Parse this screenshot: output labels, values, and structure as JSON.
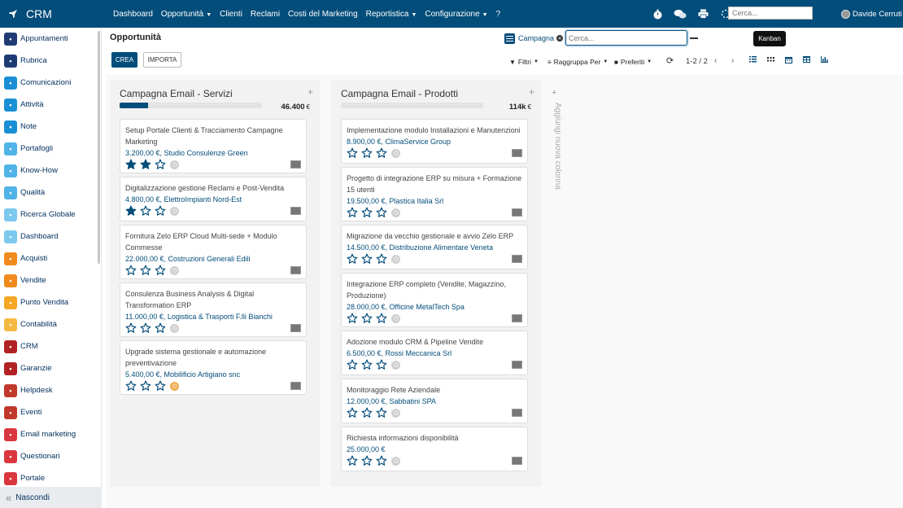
{
  "app": {
    "name": "CRM"
  },
  "topnav": {
    "items": [
      {
        "label": "Dashboard",
        "dropdown": false
      },
      {
        "label": "Opportunità",
        "dropdown": true
      },
      {
        "label": "Clienti",
        "dropdown": false
      },
      {
        "label": "Reclami",
        "dropdown": false
      },
      {
        "label": "Costi del Marketing",
        "dropdown": false
      },
      {
        "label": "Reportistica",
        "dropdown": true
      },
      {
        "label": "Configurazione",
        "dropdown": true
      },
      {
        "label": "?",
        "dropdown": false
      }
    ],
    "search_placeholder": "Cerca...",
    "user_name": "Davide Cerruti"
  },
  "sidebar": {
    "items": [
      {
        "label": "Appuntamenti",
        "color": "#1f3b73",
        "icon": "calendar-icon"
      },
      {
        "label": "Rubrica",
        "color": "#1f3b73",
        "icon": "contacts-icon"
      },
      {
        "label": "Comunicazioni",
        "color": "#1a8fd6",
        "icon": "chat-icon"
      },
      {
        "label": "Attività",
        "color": "#1a8fd6",
        "icon": "checkbox-icon"
      },
      {
        "label": "Note",
        "color": "#1a8fd6",
        "icon": "note-icon"
      },
      {
        "label": "Portafogli",
        "color": "#4fb3e8",
        "icon": "wallet-icon"
      },
      {
        "label": "Know-How",
        "color": "#4fb3e8",
        "icon": "lightbulb-icon"
      },
      {
        "label": "Qualità",
        "color": "#4fb3e8",
        "icon": "quality-icon"
      },
      {
        "label": "Ricerca Globale",
        "color": "#7cc8ee",
        "icon": "search-icon"
      },
      {
        "label": "Dashboard",
        "color": "#7cc8ee",
        "icon": "dashboard-icon"
      },
      {
        "label": "Acquisti",
        "color": "#f08a1c",
        "icon": "purchase-icon"
      },
      {
        "label": "Vendite",
        "color": "#f08a1c",
        "icon": "sales-icon"
      },
      {
        "label": "Punto Vendita",
        "color": "#f5a623",
        "icon": "pos-icon"
      },
      {
        "label": "Contabilità",
        "color": "#f5b942",
        "icon": "accounting-icon"
      },
      {
        "label": "CRM",
        "color": "#b22222",
        "icon": "crm-icon"
      },
      {
        "label": "Garanzie",
        "color": "#b22222",
        "icon": "warranty-icon"
      },
      {
        "label": "Helpdesk",
        "color": "#c0392b",
        "icon": "helpdesk-icon"
      },
      {
        "label": "Eventi",
        "color": "#c0392b",
        "icon": "events-icon"
      },
      {
        "label": "Email marketing",
        "color": "#d9363e",
        "icon": "email-icon"
      },
      {
        "label": "Questionari",
        "color": "#d9363e",
        "icon": "survey-icon"
      },
      {
        "label": "Portale",
        "color": "#d9363e",
        "icon": "portal-icon"
      }
    ],
    "hide_label": "Nascondi"
  },
  "control": {
    "title": "Opportunità",
    "create_label": "CREA",
    "import_label": "IMPORTA",
    "facet_label": "Campagna",
    "search_placeholder": "Cerca...",
    "tooltip": "Kanban",
    "filters_label": "Filtri",
    "groupby_label": "Raggruppa Per",
    "favorites_label": "Preferiti",
    "pager": "1-2 / 2"
  },
  "kanban": {
    "add_column_label": "Aggiungi nuova colonna",
    "columns": [
      {
        "title": "Campagna Email - Servizi",
        "total": "46.400",
        "currency": "€",
        "progress": 0.2,
        "cards": [
          {
            "title": "Setup Portale Clienti & Tracciamento Campagne Marketing",
            "sub": "3.200,00 €, Studio Consulenze Green",
            "stars": 2,
            "activity": "none"
          },
          {
            "title": "Digitalizzazione gestione Reclami e Post-Vendita",
            "sub": "4.800,00 €, ElettroImpianti Nord-Est",
            "stars": 1,
            "activity": "none"
          },
          {
            "title": "Fornitura Zelo ERP Cloud Multi-sede + Modulo Commesse",
            "sub": "22.000,00 €, Costruzioni Generali Edili",
            "stars": 0,
            "activity": "none"
          },
          {
            "title": "Consulenza Business Analysis & Digital Transformation ERP",
            "sub": "11.000,00 €, Logistica & Trasporti F.lli Bianchi",
            "stars": 0,
            "activity": "none"
          },
          {
            "title": "Upgrade sistema gestionale e automazione preventivazione",
            "sub": "5.400,00 €, Mobilificio Artigiano snc",
            "stars": 0,
            "activity": "warning"
          }
        ]
      },
      {
        "title": "Campagna Email - Prodotti",
        "total": "114k",
        "currency": "€",
        "progress": 0,
        "cards": [
          {
            "title": "Implementazione modulo Installazioni e Manutenzioni",
            "sub": "8.900,00 €, ClimaService Group",
            "stars": 0,
            "activity": "none"
          },
          {
            "title": "Progetto di integrazione ERP su misura + Formazione 15 utenti",
            "sub": "19.500,00 €, Plastica Italia Srl",
            "stars": 0,
            "activity": "none"
          },
          {
            "title": "Migrazione da vecchio gestionale e avvio Zelo ERP",
            "sub": "14.500,00 €, Distribuzione Alimentare Veneta",
            "stars": 0,
            "activity": "none"
          },
          {
            "title": "Integrazione ERP completo (Vendite, Magazzino, Produzione)",
            "sub": "28.000,00 €, Officine MetalTech Spa",
            "stars": 0,
            "activity": "none"
          },
          {
            "title": "Adozione modulo CRM & Pipeline Vendite",
            "sub": "6.500,00 €, Rossi Meccanica Srl",
            "stars": 0,
            "activity": "none"
          },
          {
            "title": "Monitoraggio Rete Aziendale",
            "sub": "12.000,00 €, Sabbatini SPA",
            "stars": 0,
            "activity": "none"
          },
          {
            "title": "Richiesta informazioni disponibilità",
            "sub": "25.000,00 €",
            "stars": 0,
            "activity": "none"
          }
        ]
      }
    ]
  }
}
